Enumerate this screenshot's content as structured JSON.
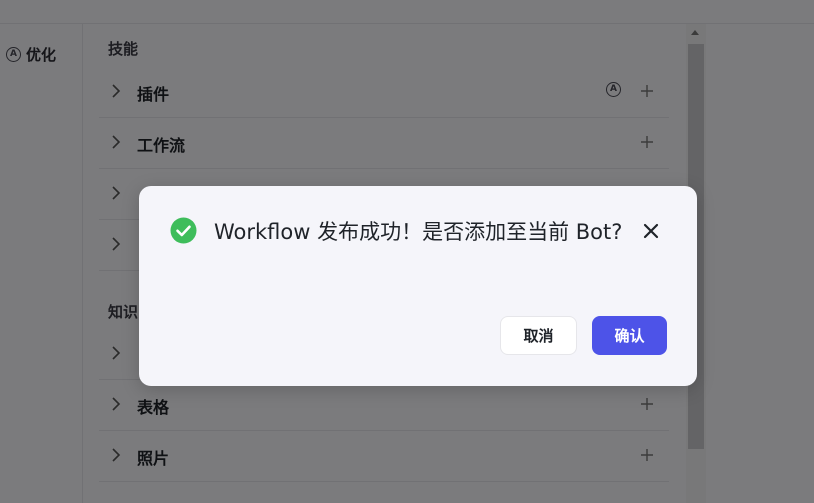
{
  "left": {
    "optimize_label": "优化",
    "optimize_icon": "auto-a-icon"
  },
  "skills": {
    "section_skills": "技能",
    "section_knowledge": "知识",
    "rows_top": [
      {
        "label": "插件",
        "has_auto": true
      },
      {
        "label": "工作流",
        "has_auto": false
      },
      {
        "label": "",
        "has_auto": false
      },
      {
        "label": "",
        "has_auto": false
      }
    ],
    "rows_bottom": [
      {
        "label": "",
        "has_auto": false
      },
      {
        "label": "表格",
        "has_auto": false
      },
      {
        "label": "照片",
        "has_auto": false
      }
    ],
    "auto_letter": "A"
  },
  "modal": {
    "message": "Workflow 发布成功！是否添加至当前 Bot?",
    "cancel_label": "取消",
    "confirm_label": "确认",
    "success_color": "#3ebd5b",
    "confirm_color": "#4d53e8",
    "icons": {
      "status": "check-circle-icon",
      "close": "close-icon"
    }
  }
}
